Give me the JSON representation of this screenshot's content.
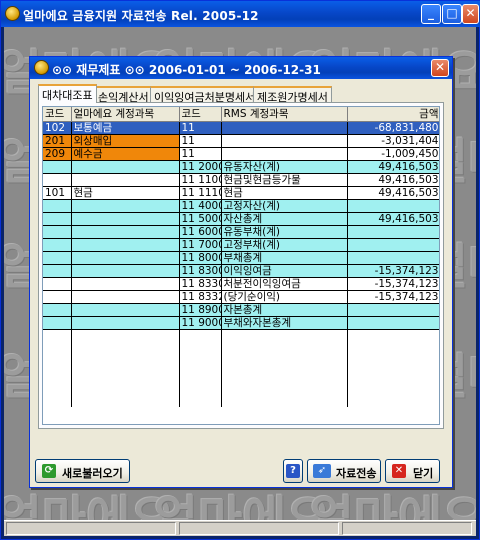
{
  "app": {
    "title": "얼마에요 금융지원 자료전송 Rel. 2005-12",
    "minimize": "_",
    "maximize": "□",
    "close": "✕",
    "watermark": "얼마에요"
  },
  "dialog": {
    "title": "⊙⊙ 재무제표 ⊙⊙ 2006-01-01 ~ 2006-12-31",
    "close": "✕",
    "tabs": [
      {
        "label": "대차대조표",
        "active": true
      },
      {
        "label": "손익계산서",
        "active": false
      },
      {
        "label": "이익잉여금처분명세서",
        "active": false
      },
      {
        "label": "제조원가명세서",
        "active": false
      }
    ],
    "table": {
      "headers": [
        "코드",
        "얼마에요 계정과목",
        "코드",
        "RMS 계정과목",
        "금액"
      ],
      "rows": [
        {
          "style": "sel",
          "code": "102",
          "name": "보통예금",
          "rcode": "11",
          "rname": "",
          "amount": "-68,831,480"
        },
        {
          "style": "orange",
          "code": "201",
          "name": "외상매입",
          "rcode": "11",
          "rname": "",
          "amount": "-3,031,404"
        },
        {
          "style": "orange",
          "code": "209",
          "name": "예수금",
          "rcode": "11",
          "rname": "",
          "amount": "-1,009,450"
        },
        {
          "style": "cyan",
          "code": "",
          "name": "",
          "rcode": "11 2000",
          "rname": "유동자산(계)",
          "amount": "49,416,503"
        },
        {
          "style": "white",
          "code": "",
          "name": "",
          "rcode": "11 1100",
          "rname": "현금및현금등가물",
          "amount": "49,416,503"
        },
        {
          "style": "white",
          "code": "101",
          "name": "현금",
          "rcode": "11 1110",
          "rname": "현금",
          "amount": "49,416,503"
        },
        {
          "style": "cyan",
          "code": "",
          "name": "",
          "rcode": "11 4000",
          "rname": "고정자산(계)",
          "amount": ""
        },
        {
          "style": "cyan",
          "code": "",
          "name": "",
          "rcode": "11 5000",
          "rname": "자산총계",
          "amount": "49,416,503"
        },
        {
          "style": "cyan",
          "code": "",
          "name": "",
          "rcode": "11 6000",
          "rname": "유동부채(계)",
          "amount": ""
        },
        {
          "style": "cyan",
          "code": "",
          "name": "",
          "rcode": "11 7000",
          "rname": "고정부채(계)",
          "amount": ""
        },
        {
          "style": "cyan",
          "code": "",
          "name": "",
          "rcode": "11 8000",
          "rname": "부채총계",
          "amount": ""
        },
        {
          "style": "cyan",
          "code": "",
          "name": "",
          "rcode": "11 8300",
          "rname": "이익잉여금",
          "amount": "-15,374,123"
        },
        {
          "style": "white",
          "code": "",
          "name": "",
          "rcode": "11 8330",
          "rname": "  처분전이익잉여금",
          "amount": "-15,374,123"
        },
        {
          "style": "white",
          "code": "",
          "name": "",
          "rcode": "11 8332",
          "rname": "  (당기순이익)",
          "amount": "-15,374,123"
        },
        {
          "style": "cyan",
          "code": "",
          "name": "",
          "rcode": "11 8900",
          "rname": "자본총계",
          "amount": ""
        },
        {
          "style": "cyan",
          "code": "",
          "name": "",
          "rcode": "11 9000",
          "rname": "부채와자본총계",
          "amount": ""
        }
      ]
    },
    "buttons": {
      "refresh": "새로불러오기",
      "help": "?",
      "transfer": "자료전송",
      "close": "닫기"
    }
  }
}
